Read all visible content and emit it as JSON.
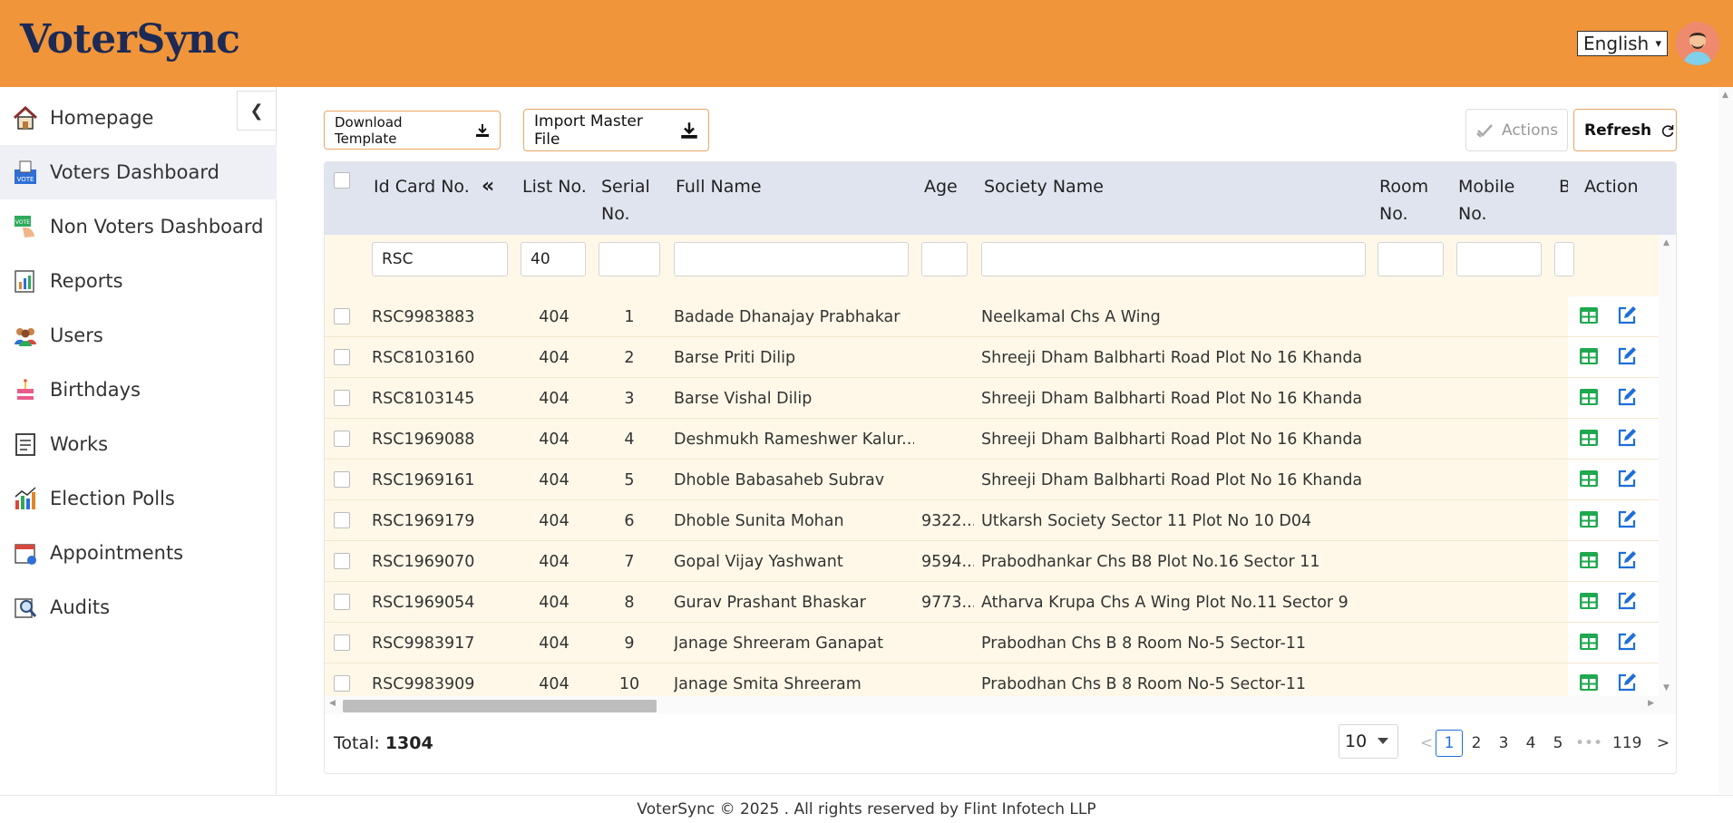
{
  "header": {
    "logo": "VoterSync",
    "language": "English"
  },
  "sidebar": {
    "items": [
      {
        "label": "Homepage",
        "icon": "home-icon"
      },
      {
        "label": "Voters Dashboard",
        "icon": "vote-box-icon",
        "active": true
      },
      {
        "label": "Non Voters Dashboard",
        "icon": "vote-hand-icon"
      },
      {
        "label": "Reports",
        "icon": "report-icon"
      },
      {
        "label": "Users",
        "icon": "users-icon"
      },
      {
        "label": "Birthdays",
        "icon": "cake-icon"
      },
      {
        "label": "Works",
        "icon": "clipboard-icon"
      },
      {
        "label": "Election Polls",
        "icon": "poll-chart-icon"
      },
      {
        "label": "Appointments",
        "icon": "calendar-icon"
      },
      {
        "label": "Audits",
        "icon": "audit-icon"
      }
    ]
  },
  "toolbar": {
    "download_template": "Download Template",
    "import_master": "Import Master File",
    "actions": "Actions",
    "refresh": "Refresh"
  },
  "table": {
    "columns": [
      "Id Card No.",
      "List No.",
      "Serial No.",
      "Full Name",
      "Age",
      "Society Name",
      "Room No.",
      "Mobile No.",
      "B",
      "Action"
    ],
    "column_lines": {
      "serial": [
        "Serial",
        "No."
      ],
      "room": [
        "Room",
        "No."
      ],
      "mobile": [
        "Mobile",
        "No."
      ]
    },
    "filters": {
      "id_card": "RSC",
      "list_no": "40"
    },
    "rows": [
      {
        "id": "RSC9983883",
        "list": "404",
        "serial": "1",
        "name": "Badade Dhanajay Prabhakar",
        "age": "",
        "society": "Neelkamal Chs A Wing"
      },
      {
        "id": "RSC8103160",
        "list": "404",
        "serial": "2",
        "name": "Barse Priti Dilip",
        "age": "",
        "society": "Shreeji Dham Balbharti Road Plot No 16 Khanda ..."
      },
      {
        "id": "RSC8103145",
        "list": "404",
        "serial": "3",
        "name": "Barse Vishal Dilip",
        "age": "",
        "society": "Shreeji Dham Balbharti Road Plot No 16 Khanda ..."
      },
      {
        "id": "RSC1969088",
        "list": "404",
        "serial": "4",
        "name": "Deshmukh Rameshwer Kalur...",
        "age": "",
        "society": "Shreeji Dham Balbharti Road Plot No 16 Khanda ..."
      },
      {
        "id": "RSC1969161",
        "list": "404",
        "serial": "5",
        "name": "Dhoble Babasaheb Subrav",
        "age": "",
        "society": "Shreeji Dham Balbharti Road Plot No 16 Khanda ..."
      },
      {
        "id": "RSC1969179",
        "list": "404",
        "serial": "6",
        "name": "Dhoble Sunita Mohan",
        "age": "9322...",
        "society": "Utkarsh Society Sector 11 Plot No 10 D04"
      },
      {
        "id": "RSC1969070",
        "list": "404",
        "serial": "7",
        "name": "Gopal Vijay Yashwant",
        "age": "9594...",
        "society": "Prabodhankar Chs B8 Plot No.16 Sector 11"
      },
      {
        "id": "RSC1969054",
        "list": "404",
        "serial": "8",
        "name": "Gurav Prashant Bhaskar",
        "age": "9773...",
        "society": "Atharva Krupa Chs A Wing Plot No.11 Sector 9"
      },
      {
        "id": "RSC9983917",
        "list": "404",
        "serial": "9",
        "name": "Janage Shreeram Ganapat",
        "age": "",
        "society": "Prabodhan Chs B 8 Room No-5 Sector-11"
      },
      {
        "id": "RSC9983909",
        "list": "404",
        "serial": "10",
        "name": "Janage Smita Shreeram",
        "age": "",
        "society": "Prabodhan Chs B 8 Room No-5 Sector-11"
      }
    ]
  },
  "pagination": {
    "total_label": "Total:",
    "total": "1304",
    "page_size": "10",
    "pages": [
      "1",
      "2",
      "3",
      "4",
      "5"
    ],
    "ellipsis": "•••",
    "last_page": "119",
    "current": "1"
  },
  "footer": {
    "text": "VoterSync © 2025 . All rights reserved by Flint Infotech LLP"
  },
  "colors": {
    "header_bg": "#f0953a",
    "logo": "#1d2a55",
    "row_bg": "#fff8e8",
    "table_head_bg": "#dfe4ef",
    "action_green": "#1fa84f",
    "action_blue": "#1e6fd9"
  }
}
